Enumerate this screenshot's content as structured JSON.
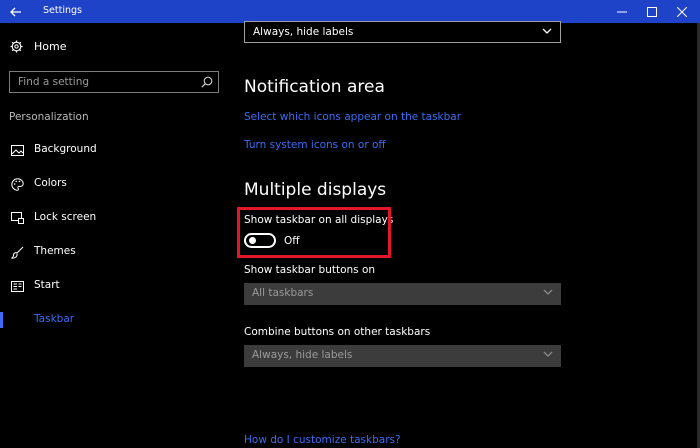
{
  "window": {
    "title": "Settings"
  },
  "sidebar": {
    "home_label": "Home",
    "search_placeholder": "Find a setting",
    "section_label": "Personalization",
    "items": [
      {
        "label": "Background",
        "icon": "image-icon"
      },
      {
        "label": "Colors",
        "icon": "palette-icon"
      },
      {
        "label": "Lock screen",
        "icon": "lock-screen-icon"
      },
      {
        "label": "Themes",
        "icon": "brush-icon"
      },
      {
        "label": "Start",
        "icon": "start-menu-icon"
      },
      {
        "label": "Taskbar",
        "icon": "taskbar-icon",
        "active": true
      }
    ]
  },
  "main": {
    "top_dropdown_value": "Always, hide labels",
    "notification_area": {
      "heading": "Notification area",
      "link1": "Select which icons appear on the taskbar",
      "link2": "Turn system icons on or off"
    },
    "multiple_displays": {
      "heading": "Multiple displays",
      "show_taskbar_label": "Show taskbar on all displays",
      "toggle_state": "Off",
      "show_buttons_label": "Show taskbar buttons on",
      "show_buttons_value": "All taskbars",
      "combine_label": "Combine buttons on other taskbars",
      "combine_value": "Always, hide labels"
    },
    "help_link": "How do I customize taskbars?"
  },
  "colors": {
    "titlebar": "#1f43c8",
    "accent": "#3b6cf5",
    "highlight": "#e3162c"
  }
}
